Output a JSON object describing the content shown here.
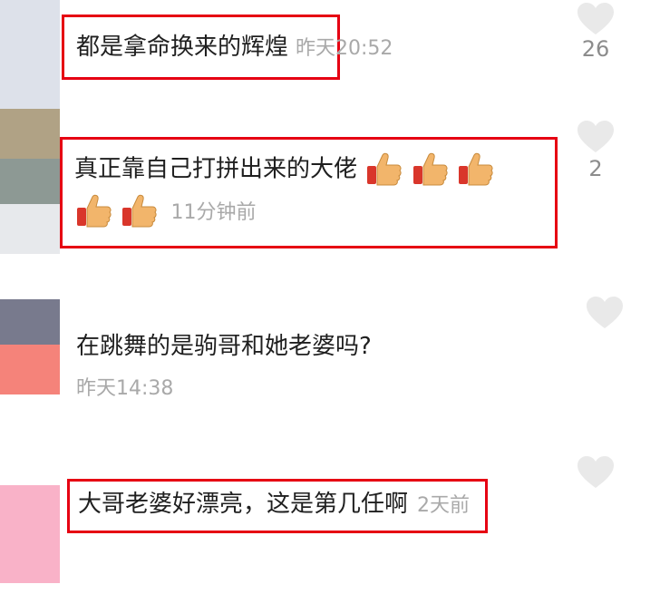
{
  "colors": {
    "highlight": "#e60012",
    "meta_text": "#a9a9a9",
    "heart": "#e9e9e9"
  },
  "comments": [
    {
      "text": "都是拿命换来的辉煌",
      "time": "昨天20:52",
      "likes": "26"
    },
    {
      "text": "真正靠自己打拼出来的大佬",
      "emoji": "thumbs-up-icon",
      "time": "11分钟前",
      "likes": "2"
    },
    {
      "text": "在跳舞的是驹哥和她老婆吗?",
      "time": "昨天14:38",
      "likes": ""
    },
    {
      "text": "大哥老婆好漂亮，这是第几任啊",
      "time": "2天前",
      "likes": ""
    }
  ]
}
